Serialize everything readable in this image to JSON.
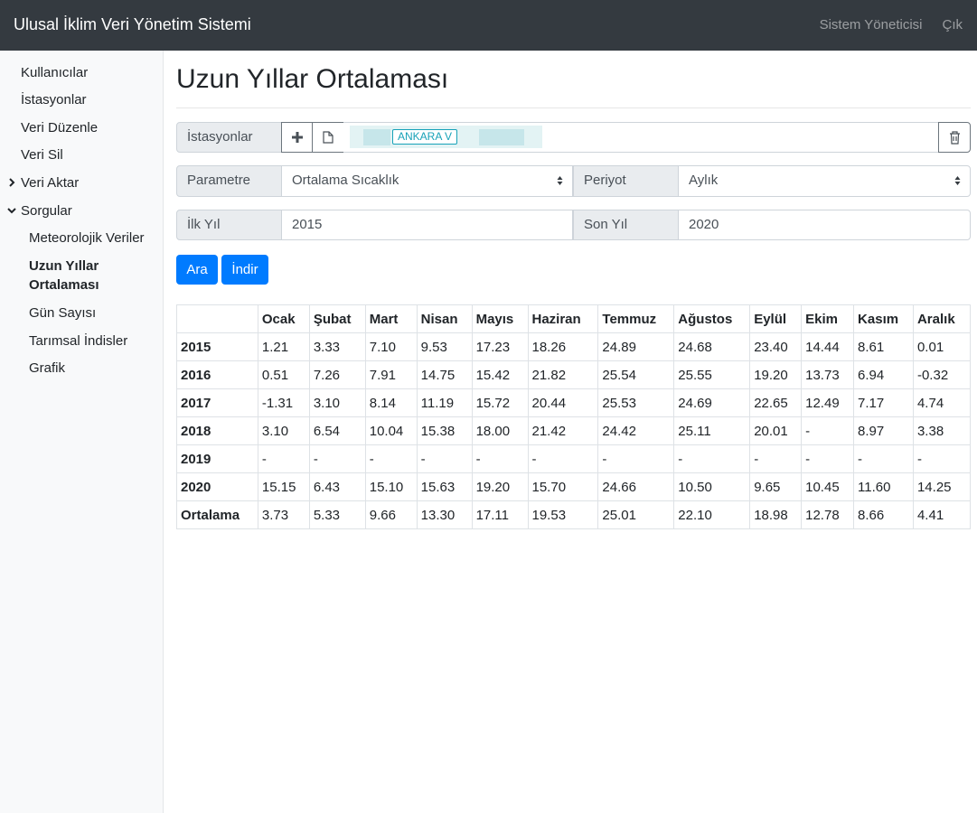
{
  "app": {
    "title": "Ulusal İklim Veri Yönetim Sistemi",
    "user_label": "Sistem Yöneticisi",
    "logout_label": "Çık"
  },
  "sidebar": {
    "items": [
      {
        "label": "Kullanıcılar"
      },
      {
        "label": "İstasyonlar"
      },
      {
        "label": "Veri Düzenle"
      },
      {
        "label": "Veri Sil"
      },
      {
        "label": "Veri Aktar",
        "icon": "chevron-right-icon"
      },
      {
        "label": "Sorgular",
        "icon": "chevron-down-icon"
      }
    ],
    "sub_items": [
      {
        "label": "Meteorolojik Veriler"
      },
      {
        "label": "Uzun Yıllar Ortalaması",
        "active": true
      },
      {
        "label": "Gün Sayısı"
      },
      {
        "label": "Tarımsal İndisler"
      },
      {
        "label": "Grafik"
      }
    ]
  },
  "page": {
    "title": "Uzun Yıllar Ortalaması"
  },
  "form": {
    "stations_label": "İstasyonlar",
    "station_tag": "ANKARA V",
    "parameter_label": "Parametre",
    "parameter_value": "Ortalama Sıcaklık",
    "period_label": "Periyot",
    "period_value": "Aylık",
    "first_year_label": "İlk Yıl",
    "first_year_value": "2015",
    "last_year_label": "Son Yıl",
    "last_year_value": "2020",
    "search_label": "Ara",
    "download_label": "İndir"
  },
  "colors": {
    "navbar": "#343a40",
    "primary": "#007bff",
    "tag": "#17a2b8"
  },
  "table": {
    "headers": [
      "",
      "Ocak",
      "Şubat",
      "Mart",
      "Nisan",
      "Mayıs",
      "Haziran",
      "Temmuz",
      "Ağustos",
      "Eylül",
      "Ekim",
      "Kasım",
      "Aralık"
    ],
    "rows": [
      [
        "2015",
        "1.21",
        "3.33",
        "7.10",
        "9.53",
        "17.23",
        "18.26",
        "24.89",
        "24.68",
        "23.40",
        "14.44",
        "8.61",
        "0.01"
      ],
      [
        "2016",
        "0.51",
        "7.26",
        "7.91",
        "14.75",
        "15.42",
        "21.82",
        "25.54",
        "25.55",
        "19.20",
        "13.73",
        "6.94",
        "-0.32"
      ],
      [
        "2017",
        "-1.31",
        "3.10",
        "8.14",
        "11.19",
        "15.72",
        "20.44",
        "25.53",
        "24.69",
        "22.65",
        "12.49",
        "7.17",
        "4.74"
      ],
      [
        "2018",
        "3.10",
        "6.54",
        "10.04",
        "15.38",
        "18.00",
        "21.42",
        "24.42",
        "25.11",
        "20.01",
        "-",
        "8.97",
        "3.38"
      ],
      [
        "2019",
        "-",
        "-",
        "-",
        "-",
        "-",
        "-",
        "-",
        "-",
        "-",
        "-",
        "-",
        "-"
      ],
      [
        "2020",
        "15.15",
        "6.43",
        "15.10",
        "15.63",
        "19.20",
        "15.70",
        "24.66",
        "10.50",
        "9.65",
        "10.45",
        "11.60",
        "14.25"
      ],
      [
        "Ortalama",
        "3.73",
        "5.33",
        "9.66",
        "13.30",
        "17.11",
        "19.53",
        "25.01",
        "22.10",
        "18.98",
        "12.78",
        "8.66",
        "4.41"
      ]
    ]
  }
}
